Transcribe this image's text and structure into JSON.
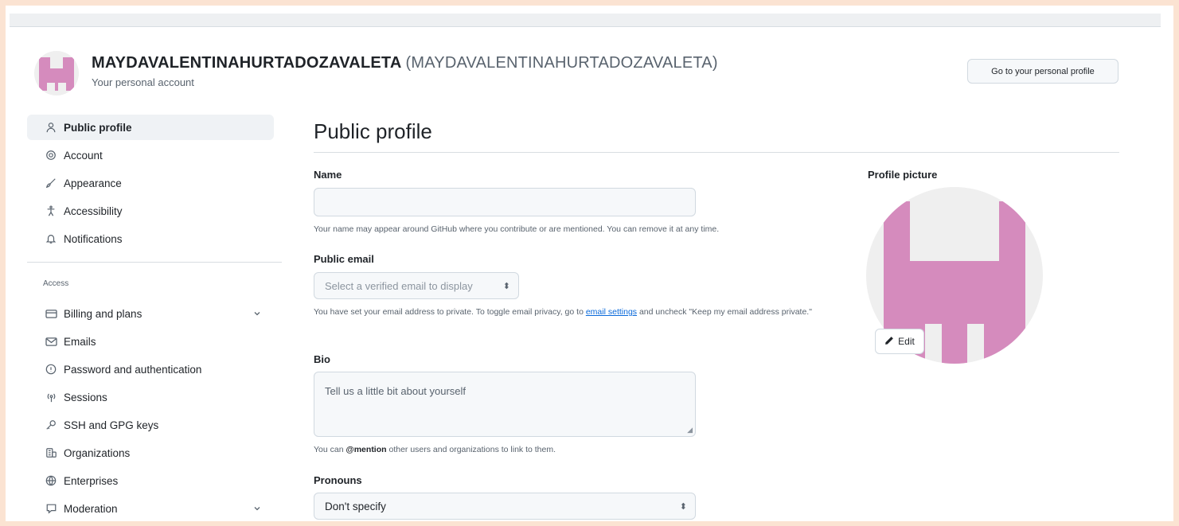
{
  "header": {
    "account_name": "MAYDAVALENTINAHURTADOZAVALETA",
    "account_handle": "(MAYDAVALENTINAHURTADOZAVALETA)",
    "subtitle": "Your personal account",
    "profile_button": "Go to your personal profile"
  },
  "sidebar": {
    "items": [
      {
        "label": "Public profile",
        "icon": "person-icon",
        "active": true
      },
      {
        "label": "Account",
        "icon": "gear-icon"
      },
      {
        "label": "Appearance",
        "icon": "paintbrush-icon"
      },
      {
        "label": "Accessibility",
        "icon": "accessibility-icon"
      },
      {
        "label": "Notifications",
        "icon": "bell-icon"
      }
    ],
    "access_heading": "Access",
    "access_items": [
      {
        "label": "Billing and plans",
        "icon": "credit-card-icon",
        "expandable": true
      },
      {
        "label": "Emails",
        "icon": "mail-icon"
      },
      {
        "label": "Password and authentication",
        "icon": "shield-lock-icon"
      },
      {
        "label": "Sessions",
        "icon": "broadcast-icon"
      },
      {
        "label": "SSH and GPG keys",
        "icon": "key-icon"
      },
      {
        "label": "Organizations",
        "icon": "organization-icon"
      },
      {
        "label": "Enterprises",
        "icon": "globe-icon"
      },
      {
        "label": "Moderation",
        "icon": "comment-icon",
        "expandable": true
      }
    ]
  },
  "main": {
    "title": "Public profile",
    "name": {
      "label": "Name",
      "value": "",
      "note": "Your name may appear around GitHub where you contribute or are mentioned. You can remove it at any time."
    },
    "public_email": {
      "label": "Public email",
      "placeholder": "Select a verified email to display",
      "note_before": "You have set your email address to private. To toggle email privacy, go to ",
      "note_link": "email settings",
      "note_after": " and uncheck \"Keep my email address private.\""
    },
    "bio": {
      "label": "Bio",
      "placeholder": "Tell us a little bit about yourself",
      "note_before": "You can ",
      "note_mention": "@mention",
      "note_after": " other users and organizations to link to them."
    },
    "pronouns": {
      "label": "Pronouns",
      "selected": "Don't specify"
    }
  },
  "profile_picture": {
    "label": "Profile picture",
    "edit_label": "Edit",
    "avatar_color": "#d58bbd"
  },
  "colors": {
    "accent": "#0969da",
    "page_border": "#fbe3d2"
  }
}
